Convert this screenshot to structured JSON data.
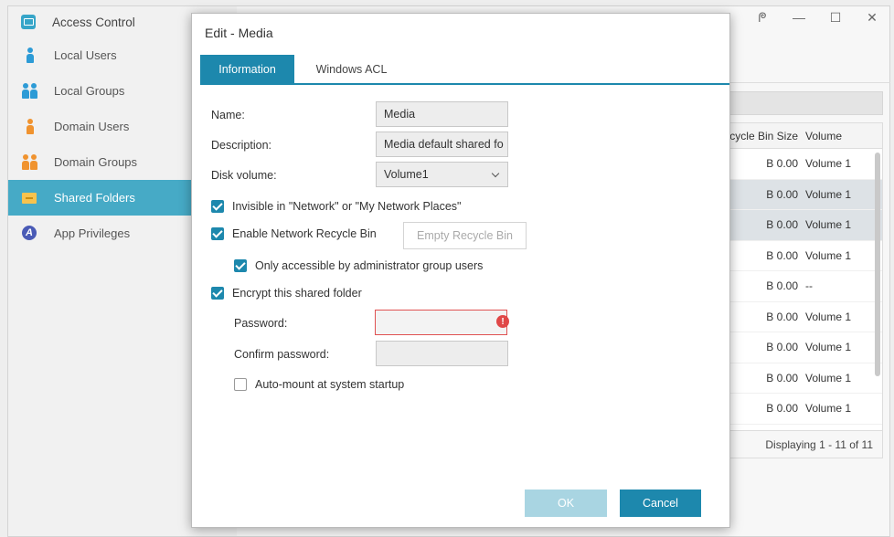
{
  "app": {
    "title": "Access Control",
    "window_controls": [
      "ᖘ",
      "—",
      "☐",
      "✕"
    ]
  },
  "sidebar": {
    "items": [
      {
        "label": "Local Users",
        "icon": "user-icon"
      },
      {
        "label": "Local Groups",
        "icon": "group-icon"
      },
      {
        "label": "Domain Users",
        "icon": "domain-user-icon"
      },
      {
        "label": "Domain Groups",
        "icon": "domain-group-icon"
      },
      {
        "label": "Shared Folders",
        "icon": "folder-icon",
        "active": true
      },
      {
        "label": "App Privileges",
        "icon": "app-privilege-icon"
      }
    ]
  },
  "table": {
    "headers": {
      "size": "Recycle Bin Size",
      "volume": "Volume"
    },
    "rows": [
      {
        "size": "0.00 B",
        "volume": "Volume 1"
      },
      {
        "size": "0.00 B",
        "volume": "Volume 1"
      },
      {
        "size": "0.00 B",
        "volume": "Volume 1"
      },
      {
        "size": "0.00 B",
        "volume": "Volume 1"
      },
      {
        "size": "0.00 B",
        "volume": "--"
      },
      {
        "size": "0.00 B",
        "volume": "Volume 1"
      },
      {
        "size": "0.00 B",
        "volume": "Volume 1"
      },
      {
        "size": "0.00 B",
        "volume": "Volume 1"
      },
      {
        "size": "0.00 B",
        "volume": "Volume 1"
      }
    ],
    "footer": "Displaying 1 - 11 of 11"
  },
  "dialog": {
    "title": "Edit - Media",
    "tabs": [
      "Information",
      "Windows ACL"
    ],
    "name_label": "Name:",
    "name_value": "Media",
    "description_label": "Description:",
    "description_value": "Media default shared fo",
    "disk_label": "Disk volume:",
    "disk_value": "Volume1",
    "invisible_label": "Invisible in \"Network\" or \"My Network Places\"",
    "recycle_label": "Enable Network Recycle Bin",
    "empty_recycle_label": "Empty Recycle Bin",
    "admin_only_label": "Only accessible by administrator group users",
    "encrypt_label": "Encrypt this shared folder",
    "password_label": "Password:",
    "confirm_label": "Confirm password:",
    "automount_label": "Auto-mount at system startup",
    "ok_label": "OK",
    "cancel_label": "Cancel",
    "checked": {
      "invisible": true,
      "recycle": true,
      "admin_only": true,
      "encrypt": true,
      "automount": false
    }
  }
}
